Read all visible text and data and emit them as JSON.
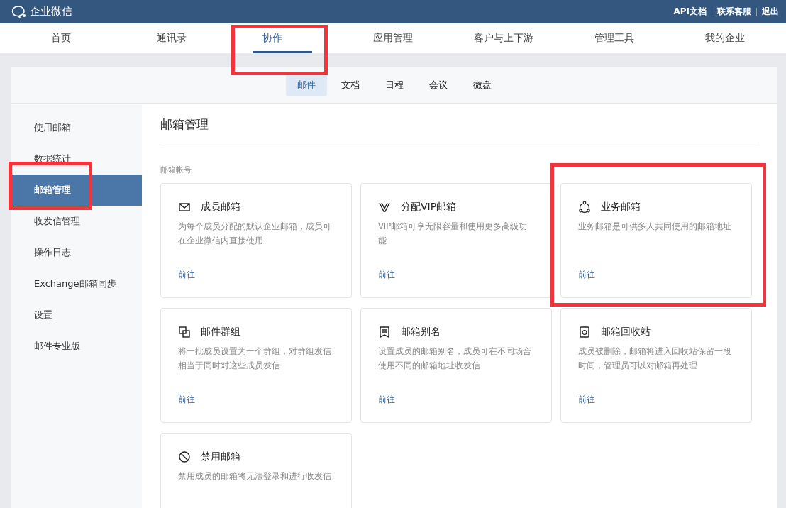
{
  "topbar": {
    "logo": "企业微信",
    "links": [
      "API文档",
      "联系客服",
      "退出"
    ]
  },
  "nav": [
    {
      "label": "首页",
      "selected": false,
      "highlighted": false
    },
    {
      "label": "通讯录",
      "selected": false,
      "highlighted": false
    },
    {
      "label": "协作",
      "selected": true,
      "highlighted": true
    },
    {
      "label": "应用管理",
      "selected": false,
      "highlighted": false
    },
    {
      "label": "客户与上下游",
      "selected": false,
      "highlighted": false
    },
    {
      "label": "管理工具",
      "selected": false,
      "highlighted": false
    },
    {
      "label": "我的企业",
      "selected": false,
      "highlighted": false
    }
  ],
  "subtabs": [
    {
      "label": "邮件",
      "selected": true
    },
    {
      "label": "文档",
      "selected": false
    },
    {
      "label": "日程",
      "selected": false
    },
    {
      "label": "会议",
      "selected": false
    },
    {
      "label": "微盘",
      "selected": false
    }
  ],
  "sidebar": {
    "items": [
      {
        "label": "使用邮箱",
        "selected": false,
        "highlighted": false
      },
      {
        "label": "数据统计",
        "selected": false,
        "highlighted": false
      },
      {
        "label": "邮箱管理",
        "selected": true,
        "highlighted": true
      },
      {
        "label": "收发信管理",
        "selected": false,
        "highlighted": false
      },
      {
        "label": "操作日志",
        "selected": false,
        "highlighted": false
      },
      {
        "label": "Exchange邮箱同步",
        "selected": false,
        "highlighted": false
      },
      {
        "label": "设置",
        "selected": false,
        "highlighted": false
      },
      {
        "label": "邮件专业版",
        "selected": false,
        "highlighted": false
      }
    ]
  },
  "content": {
    "title": "邮箱管理",
    "section_label": "邮箱帐号",
    "cards": [
      {
        "kind": "envelope",
        "title": "成员邮箱",
        "description": "为每个成员分配的默认企业邮箱，成员可在企业微信内直接使用",
        "link": "前往",
        "highlighted": false
      },
      {
        "kind": "vip",
        "title": "分配VIP邮箱",
        "description": "VIP邮箱可享无限容量和使用更多高级功能",
        "link": "前往",
        "highlighted": false
      },
      {
        "kind": "share",
        "title": "业务邮箱",
        "description": "业务邮箱是可供多人共同使用的邮箱地址",
        "link": "前往",
        "highlighted": true
      },
      {
        "kind": "group",
        "title": "邮件群组",
        "description": "将一批成员设置为一个群组，对群组发信相当于同时对这些成员发信",
        "link": "前往",
        "highlighted": false
      },
      {
        "kind": "alias",
        "title": "邮箱别名",
        "description": "设置成员的邮箱别名，成员可在不同场合使用不同的邮箱地址收发信",
        "link": "前往",
        "highlighted": false
      },
      {
        "kind": "recycle",
        "title": "邮箱回收站",
        "description": "成员被删除，邮箱将进入回收站保留一段时间，管理员可以对邮箱再处理",
        "link": "前往",
        "highlighted": false
      },
      {
        "kind": "ban",
        "title": "禁用邮箱",
        "description": "禁用成员的邮箱将无法登录和进行收发信",
        "highlighted": false
      }
    ]
  }
}
